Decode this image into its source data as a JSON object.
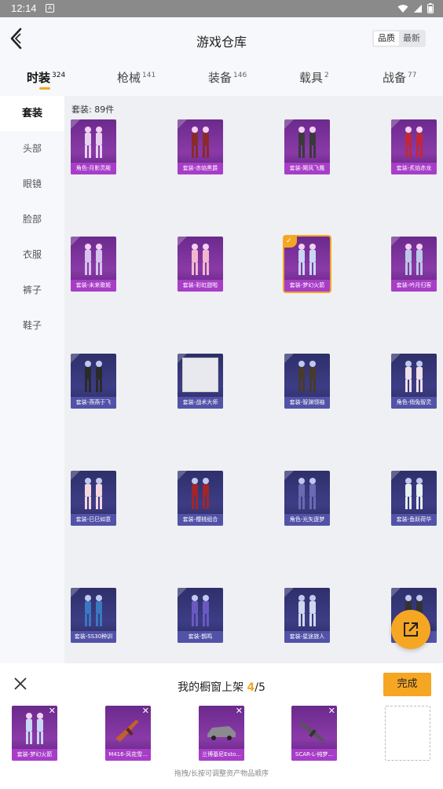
{
  "status": {
    "time": "12:14",
    "notif_glyph": "A"
  },
  "header": {
    "title": "游戏仓库",
    "sort_options": [
      "品质",
      "最新"
    ]
  },
  "tabs": [
    {
      "label": "时装",
      "count": "324"
    },
    {
      "label": "枪械",
      "count": "141"
    },
    {
      "label": "装备",
      "count": "146"
    },
    {
      "label": "载具",
      "count": "2"
    },
    {
      "label": "战备",
      "count": "77"
    }
  ],
  "sidebar": [
    "套装",
    "头部",
    "眼镜",
    "脸部",
    "衣服",
    "裤子",
    "鞋子"
  ],
  "content": {
    "count_text": "套装: 89件",
    "items": [
      {
        "label": "角色-月影灵殿",
        "tone": "purple"
      },
      {
        "label": "套装-赤焰黑爵",
        "tone": "purple"
      },
      {
        "label": "套装-飓风飞鹰",
        "tone": "purple"
      },
      {
        "label": "套装-炙焰赤龙",
        "tone": "purple"
      },
      {
        "label": "套装-未来歌姬",
        "tone": "purple"
      },
      {
        "label": "套装-彩虹甜啦",
        "tone": "purple"
      },
      {
        "label": "套装-梦幻火箭",
        "tone": "purple"
      },
      {
        "label": "套装-吟月归客",
        "tone": "purple"
      },
      {
        "label": "套装-燕燕于飞",
        "tone": "blue"
      },
      {
        "label": "套装-战术大师",
        "tone": "blue"
      },
      {
        "label": "套装-智渊领袖",
        "tone": "blue"
      },
      {
        "label": "角色-俏兔智灵",
        "tone": "blue"
      },
      {
        "label": "套装-巳巳如意",
        "tone": "blue"
      },
      {
        "label": "套装-樱桃组合",
        "tone": "blue"
      },
      {
        "label": "角色-光矢逐梦",
        "tone": "blue"
      },
      {
        "label": "套装-鱼跃荷华",
        "tone": "blue"
      },
      {
        "label": "套装-SS30种训",
        "tone": "blue"
      },
      {
        "label": "套装-鹊鸣",
        "tone": "blue"
      },
      {
        "label": "套装-星途旅人",
        "tone": "blue"
      },
      {
        "label": "",
        "tone": "blue"
      }
    ]
  },
  "panel": {
    "title_prefix": "我的橱窗上架",
    "current": "4",
    "total": "/5",
    "done_label": "完成",
    "items": [
      "套装-梦幻火箭",
      "M416-风花雪...",
      "兰博基尼Esto...",
      "SCAR-L-纯梦..."
    ],
    "hint": "拖拽/长按可调整资产物品顺序"
  },
  "colors": {
    "accent": "#f5a623",
    "purple_card": "#8a3aa8",
    "blue_card": "#3d3d86"
  }
}
